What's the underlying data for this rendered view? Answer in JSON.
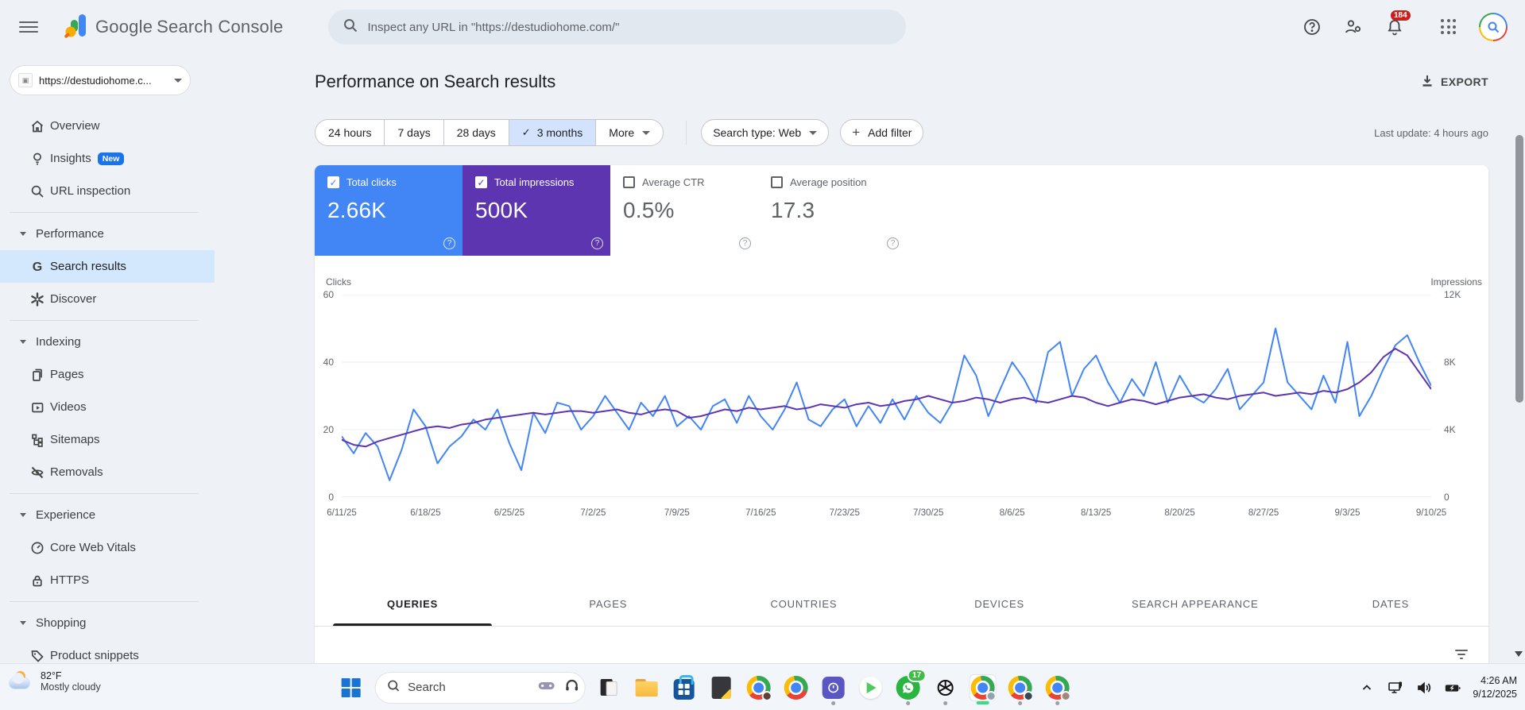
{
  "header": {
    "product_google": "Google",
    "product_rest": "Search Console",
    "search_placeholder": "Inspect any URL in \"https://destudiohome.com/\"",
    "notification_count": "184"
  },
  "property": {
    "label": "https://destudiohome.c..."
  },
  "sidebar": {
    "items": [
      {
        "type": "item",
        "icon": "home",
        "label": "Overview"
      },
      {
        "type": "item",
        "icon": "insights",
        "label": "Insights",
        "badge": "New"
      },
      {
        "type": "item",
        "icon": "url-inspection",
        "label": "URL inspection"
      },
      {
        "type": "divider"
      },
      {
        "type": "section",
        "label": "Performance"
      },
      {
        "type": "item",
        "icon": "search-results",
        "label": "Search results",
        "selected": true
      },
      {
        "type": "item",
        "icon": "discover",
        "label": "Discover"
      },
      {
        "type": "divider"
      },
      {
        "type": "section",
        "label": "Indexing"
      },
      {
        "type": "item",
        "icon": "pages",
        "label": "Pages"
      },
      {
        "type": "item",
        "icon": "videos",
        "label": "Videos"
      },
      {
        "type": "item",
        "icon": "sitemaps",
        "label": "Sitemaps"
      },
      {
        "type": "item",
        "icon": "removals",
        "label": "Removals"
      },
      {
        "type": "divider"
      },
      {
        "type": "section",
        "label": "Experience"
      },
      {
        "type": "item",
        "icon": "core-web-vitals",
        "label": "Core Web Vitals"
      },
      {
        "type": "item",
        "icon": "https",
        "label": "HTTPS"
      },
      {
        "type": "divider"
      },
      {
        "type": "section",
        "label": "Shopping"
      },
      {
        "type": "item",
        "icon": "product-snippets",
        "label": "Product snippets"
      }
    ]
  },
  "page": {
    "title": "Performance on Search results",
    "export_label": "EXPORT",
    "last_update": "Last update: 4 hours ago",
    "date_filters": [
      {
        "label": "24 hours"
      },
      {
        "label": "7 days"
      },
      {
        "label": "28 days"
      },
      {
        "label": "3 months",
        "selected": true
      },
      {
        "label": "More",
        "dropdown": true
      }
    ],
    "search_type_chip": "Search type: Web",
    "add_filter_chip": "Add filter",
    "active_tab": "QUERIES"
  },
  "metrics": [
    {
      "name": "total-clicks",
      "label": "Total clicks",
      "value": "2.66K",
      "checked": true,
      "bg": "#4285f4",
      "colored": true
    },
    {
      "name": "total-impressions",
      "label": "Total impressions",
      "value": "500K",
      "checked": true,
      "bg": "#5e35b1",
      "colored": true
    },
    {
      "name": "average-ctr",
      "label": "Average CTR",
      "value": "0.5%",
      "checked": false,
      "bg": "#ffffff",
      "colored": false
    },
    {
      "name": "average-position",
      "label": "Average position",
      "value": "17.3",
      "checked": false,
      "bg": "#ffffff",
      "colored": false
    }
  ],
  "tabs": [
    "QUERIES",
    "PAGES",
    "COUNTRIES",
    "DEVICES",
    "SEARCH APPEARANCE",
    "DATES"
  ],
  "chart_data": {
    "type": "line",
    "legend_position": "none",
    "grid": true,
    "left_axis": {
      "label": "Clicks",
      "max": 60,
      "ticks": [
        0,
        20,
        40,
        60
      ],
      "tick_labels": [
        "0",
        "20",
        "40",
        "60"
      ]
    },
    "right_axis": {
      "label": "Impressions",
      "max": 12000,
      "ticks": [
        0,
        4000,
        8000,
        12000
      ],
      "tick_labels": [
        "0",
        "4K",
        "8K",
        "12K"
      ]
    },
    "x_tick_labels": [
      "6/11/25",
      "6/18/25",
      "6/25/25",
      "7/2/25",
      "7/9/25",
      "7/16/25",
      "7/23/25",
      "7/30/25",
      "8/6/25",
      "8/13/25",
      "8/20/25",
      "8/27/25",
      "9/3/25",
      "9/10/25"
    ],
    "x_tick_indices": [
      0,
      7,
      14,
      21,
      28,
      35,
      42,
      49,
      56,
      63,
      70,
      77,
      84,
      91
    ],
    "series": [
      {
        "name": "Clicks",
        "axis": "left",
        "color": "#4285f4",
        "values": [
          18,
          13,
          19,
          15,
          5,
          14,
          26,
          21,
          10,
          15,
          18,
          23,
          20,
          26,
          16,
          8,
          25,
          19,
          28,
          27,
          20,
          24,
          30,
          25,
          20,
          28,
          24,
          30,
          21,
          24,
          20,
          27,
          29,
          22,
          30,
          24,
          20,
          26,
          34,
          23,
          21,
          26,
          29,
          21,
          27,
          22,
          29,
          23,
          30,
          25,
          22,
          28,
          42,
          36,
          24,
          32,
          40,
          35,
          28,
          43,
          46,
          30,
          38,
          42,
          34,
          28,
          35,
          30,
          40,
          28,
          36,
          30,
          28,
          32,
          38,
          26,
          30,
          34,
          50,
          34,
          30,
          26,
          36,
          28,
          46,
          24,
          30,
          38,
          45,
          48,
          40,
          33
        ]
      },
      {
        "name": "Impressions",
        "axis": "right",
        "color": "#5e35b1",
        "values": [
          3400,
          3100,
          3000,
          3300,
          3500,
          3700,
          3900,
          4100,
          4200,
          4100,
          4300,
          4400,
          4600,
          4700,
          4800,
          4900,
          5000,
          4900,
          5000,
          5100,
          5100,
          5000,
          5100,
          5200,
          5000,
          4900,
          5100,
          5200,
          5100,
          4700,
          4800,
          5000,
          5200,
          5100,
          5300,
          5200,
          5300,
          5400,
          5200,
          5300,
          5500,
          5400,
          5300,
          5500,
          5600,
          5400,
          5500,
          5700,
          5800,
          6000,
          5800,
          5600,
          5700,
          5900,
          5800,
          5600,
          5800,
          5900,
          5700,
          5600,
          5800,
          6000,
          5900,
          5600,
          5400,
          5600,
          5800,
          5700,
          5500,
          5700,
          5900,
          6000,
          6100,
          5900,
          5800,
          6000,
          6100,
          6200,
          6000,
          6100,
          6200,
          6100,
          6300,
          6200,
          6400,
          6800,
          7400,
          8300,
          8800,
          8400,
          7400,
          6400
        ]
      }
    ]
  },
  "taskbar": {
    "weather_temp": "82°F",
    "weather_desc": "Mostly cloudy",
    "search_label": "Search",
    "whatsapp_badge": "17",
    "time": "4:26 AM",
    "date": "9/12/2025"
  },
  "colors": {
    "accent_blue": "#4285f4",
    "accent_purple": "#5e35b1",
    "selected_chip_bg": "#d3e3fd",
    "sidebar_selected_bg": "#d3e8fd",
    "notification_red": "#c5221f"
  }
}
